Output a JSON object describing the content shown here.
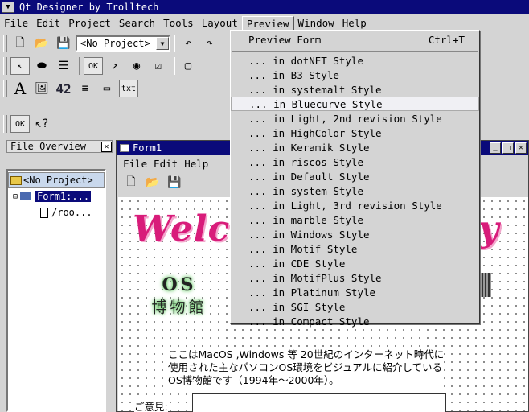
{
  "app": {
    "title": "Qt Designer by Trolltech"
  },
  "menubar": {
    "items": [
      "File",
      "Edit",
      "Project",
      "Search",
      "Tools",
      "Layout",
      "Preview",
      "Window",
      "Help"
    ],
    "open_index": 6
  },
  "toolbar": {
    "project_combo": "<No Project>",
    "text_label": "42"
  },
  "file_overview": {
    "title": "File Overview",
    "close": "✕",
    "project": "<No Project>",
    "form": "Form1:...",
    "child": "/roo..."
  },
  "form_window": {
    "title": "Form1",
    "menu": [
      "File",
      "Edit",
      "Help"
    ],
    "welcome_left": "Welcom",
    "welcome_right": "y",
    "os_line1": "OS",
    "os_line2": "博物館",
    "jp_text": [
      "ここはMacOS ,Windows 等 20世紀のインターネット時代に",
      "使用された主なパソコンOS環境をビジュアルに紹介している",
      "OS博物館です（1994年〜2000年）。"
    ],
    "opinion_label": "ご意見:"
  },
  "preview_menu": {
    "preview_form": "Preview Form",
    "shortcut": "Ctrl+T",
    "highlight_index": 3,
    "items": [
      "... in dotNET Style",
      "... in B3 Style",
      "... in systemalt Style",
      "... in Bluecurve Style",
      "... in Light, 2nd revision Style",
      "... in HighColor Style",
      "... in Keramik Style",
      "... in riscos Style",
      "... in Default Style",
      "... in system Style",
      "... in Light, 3rd revision Style",
      "... in marble Style",
      "... in Windows Style",
      "... in Motif Style",
      "... in CDE Style",
      "... in MotifPlus Style",
      "... in Platinum Style",
      "... in SGI Style",
      "... in Compact Style"
    ]
  }
}
